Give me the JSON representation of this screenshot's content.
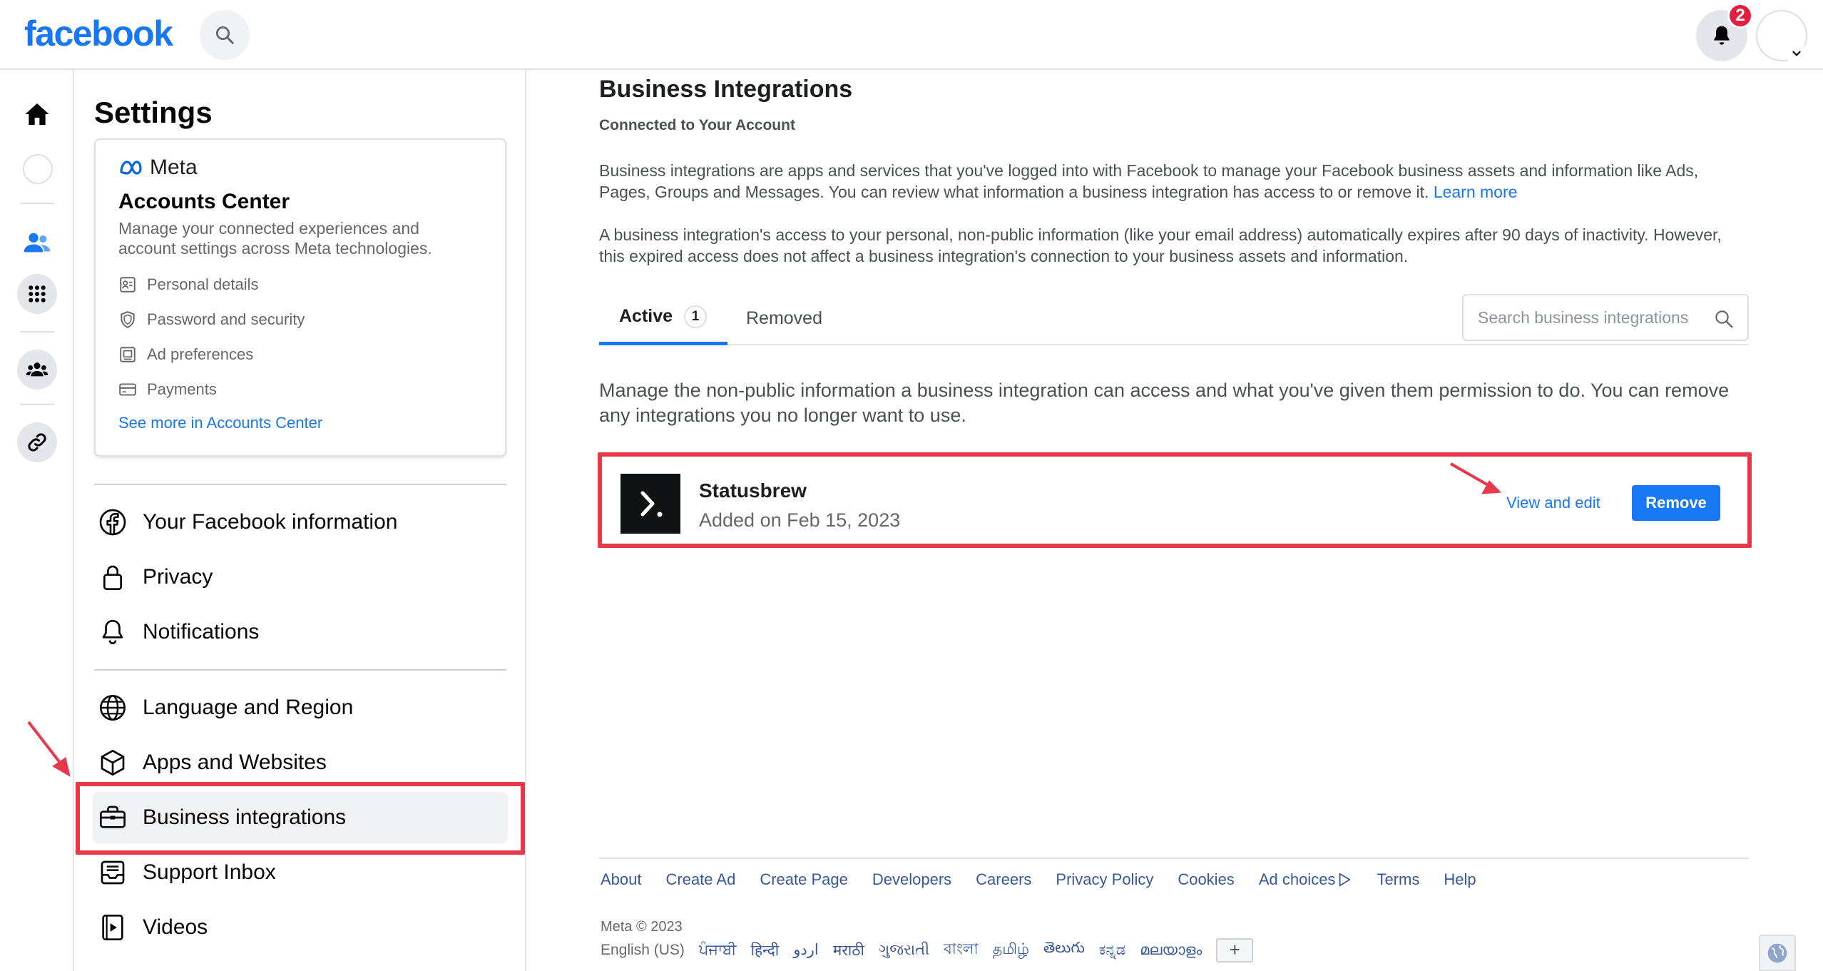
{
  "header": {
    "logo": "facebook",
    "notification_count": "2"
  },
  "settings": {
    "title": "Settings",
    "accounts_center": {
      "brand": "Meta",
      "title": "Accounts Center",
      "description": "Manage your connected experiences and account settings across Meta technologies.",
      "items": [
        {
          "label": "Personal details",
          "icon": "id-card-icon"
        },
        {
          "label": "Password and security",
          "icon": "shield-icon"
        },
        {
          "label": "Ad preferences",
          "icon": "monitor-icon"
        },
        {
          "label": "Payments",
          "icon": "credit-card-icon"
        }
      ],
      "see_more": "See more in Accounts Center"
    },
    "nav": [
      {
        "label": "Your Facebook information",
        "icon": "facebook-icon"
      },
      {
        "label": "Privacy",
        "icon": "lock-icon"
      },
      {
        "label": "Notifications",
        "icon": "bell-icon"
      },
      {
        "label": "Language and Region",
        "icon": "globe-icon"
      },
      {
        "label": "Apps and Websites",
        "icon": "cube-icon"
      },
      {
        "label": "Business integrations",
        "icon": "briefcase-icon",
        "active": true
      },
      {
        "label": "Support Inbox",
        "icon": "inbox-icon"
      },
      {
        "label": "Videos",
        "icon": "video-icon"
      }
    ]
  },
  "main": {
    "title": "Business Integrations",
    "subtitle": "Connected to Your Account",
    "para1": "Business integrations are apps and services that you've logged into with Facebook to manage your Facebook business assets and information like Ads, Pages, Groups and Messages. You can review what information a business integration has access to or remove it.",
    "learn_more": "Learn more",
    "para2": "A business integration's access to your personal, non-public information (like your email address) automatically expires after 90 days of inactivity. However, this expired access does not affect a business integration's connection to your business assets and information.",
    "tabs": {
      "active_label": "Active",
      "active_count": "1",
      "removed_label": "Removed"
    },
    "search_placeholder": "Search business integrations",
    "manage_text": "Manage the non-public information a business integration can access and what you've given them permission to do. You can remove any integrations you no longer want to use.",
    "integration": {
      "name": "Statusbrew",
      "added": "Added on Feb 15, 2023",
      "view_edit": "View and edit",
      "remove": "Remove"
    }
  },
  "footer": {
    "links": [
      "About",
      "Create Ad",
      "Create Page",
      "Developers",
      "Careers",
      "Privacy Policy",
      "Cookies",
      "Ad choices",
      "Terms",
      "Help"
    ],
    "copyright": "Meta © 2023",
    "current_language": "English (US)",
    "languages": [
      "ਪੰਜਾਬੀ",
      "हिन्दी",
      "اردو",
      "मराठी",
      "ગુજરાતી",
      "বাংলা",
      "தமிழ்",
      "తెలుగు",
      "ಕನ್ನಡ",
      "മലയാളം"
    ],
    "more_languages": "+"
  },
  "colors": {
    "brand": "#1877f2",
    "highlight": "#e8394b"
  }
}
